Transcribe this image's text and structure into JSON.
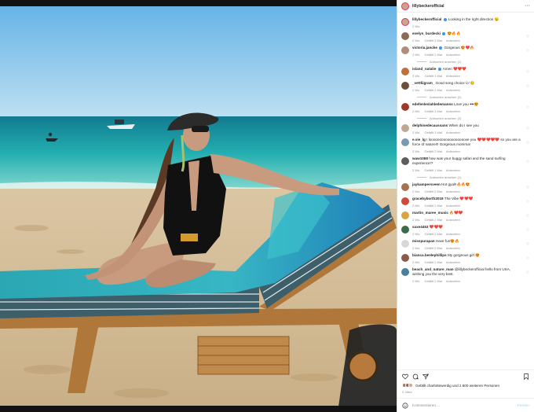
{
  "post": {
    "username": "lillybeckerofficial",
    "caption_user": "lillybeckerofficial",
    "caption_text": "Looking in the right direction 😉",
    "caption_time": "2 Wo."
  },
  "labels": {
    "likes_word": "Gefällt",
    "reply_word": "Antworten",
    "likes_suffix": "Mal"
  },
  "comments": [
    {
      "user": "evelyn_burdecki",
      "verified": true,
      "text": "😍🔥🔥",
      "time": "2 Wo.",
      "likes": "Gefällt 3 Mal",
      "reply": "Antworten",
      "avatar": "#8a6d55"
    },
    {
      "user": "victoria.jancke",
      "verified": true,
      "text": "Gorgeous 😍❤️🔥",
      "time": "2 Wo.",
      "likes": "Gefällt 2 Mal",
      "reply": "Antworten",
      "avatar": "#b08c7a",
      "replies": "Antworten ansehen (1)"
    },
    {
      "user": "island_natalie",
      "verified": true,
      "text": "Amen ❤️❤️❤️",
      "time": "2 Wo.",
      "likes": "Gefällt 3 Mal",
      "reply": "Antworten",
      "avatar": "#c2703b"
    },
    {
      "user": "_vettliigram_",
      "verified": false,
      "text": "Good song choice 🎶😊",
      "time": "2 Wo.",
      "likes": "Gefällt 2 Mal",
      "reply": "Antworten",
      "avatar": "#6b4f3a",
      "replies": "Antworten ansehen (2)"
    },
    {
      "user": "edefenleslahledemanns",
      "verified": false,
      "text": "Love you 🕶️😍",
      "time": "2 Wo.",
      "likes": "Gefällt 3 Mal",
      "reply": "Antworten",
      "avatar": "#9c3b2a",
      "replies": "Antworten ansehen (3)"
    },
    {
      "user": "delphinedecaussans",
      "verified": false,
      "text": "When do I see you",
      "time": "2 Wo.",
      "likes": "Gefällt 3 Mal",
      "reply": "Antworten",
      "avatar": "#bfa890"
    },
    {
      "user": "e.vie_lg",
      "verified": false,
      "text": "I loooooooooooooooooove you ❤️❤️❤️❤️❤️ so you are a force of nature!!! Gorgeous momma!",
      "time": "2 Wo.",
      "likes": "Gefällt 2 Mal",
      "reply": "Antworten",
      "avatar": "#7a9ab0"
    },
    {
      "user": "waw1068",
      "verified": false,
      "text": "how was your buggy safari and the sand surfing experience!?",
      "time": "2 Wo.",
      "likes": "Gefällt 1 Mal",
      "reply": "Antworten",
      "avatar": "#5d5d5d",
      "replies": "Antworten ansehen (1)"
    },
    {
      "user": "jaykampersveen",
      "verified": false,
      "text": "Hot gyal!!🔥🔥😍",
      "time": "2 Wo.",
      "likes": "Gefällt 2 Mal",
      "reply": "Antworten",
      "avatar": "#a3734f"
    },
    {
      "user": "gracebyborth2019",
      "verified": false,
      "text": "The Vibe ❤️❤️❤️",
      "time": "2 Wo.",
      "likes": "Gefällt 2 Mal",
      "reply": "Antworten",
      "avatar": "#d04a3a"
    },
    {
      "user": "martin_maree_music",
      "verified": false,
      "text": "🔥❤️❤️",
      "time": "2 Wo.",
      "likes": "Gefällt 2 Mal",
      "reply": "Antworten",
      "avatar": "#d9a441"
    },
    {
      "user": "saxe4453",
      "verified": false,
      "text": "❤️❤️❤️",
      "time": "2 Wo.",
      "likes": "Gefällt 2 Mal",
      "reply": "Antworten",
      "avatar": "#3d6b4a"
    },
    {
      "user": "misspurapan",
      "verified": false,
      "text": "Have fun😍🔥",
      "time": "2 Wo.",
      "likes": "Gefällt 2 Mal",
      "reply": "Antworten",
      "avatar": "#d8d8d8"
    },
    {
      "user": "bianca.beelephillips",
      "verified": false,
      "text": "My gorgeous girl 😍",
      "time": "2 Wo.",
      "likes": "Gefällt 2 Mal",
      "reply": "Antworten",
      "avatar": "#8c5a4a"
    },
    {
      "user": "beach_and_nature_man",
      "verified": false,
      "text": "@lillybeckerofficial hello from USA, wishing you the very best.",
      "time": "2 Wo.",
      "likes": "Gefällt 2 Mal",
      "reply": "Antworten",
      "avatar": "#4a7fa0"
    }
  ],
  "footer": {
    "liked_by": "Gefällt charlottewerdig und 2.600 weiteren Personen",
    "date": "2. März",
    "add_comment_placeholder": "Kommentieren ...",
    "post_button": "Posten"
  },
  "colors": {
    "accent_blue": "#3897f0",
    "heart": "#e0245e",
    "muted": "#8e8e8e"
  }
}
